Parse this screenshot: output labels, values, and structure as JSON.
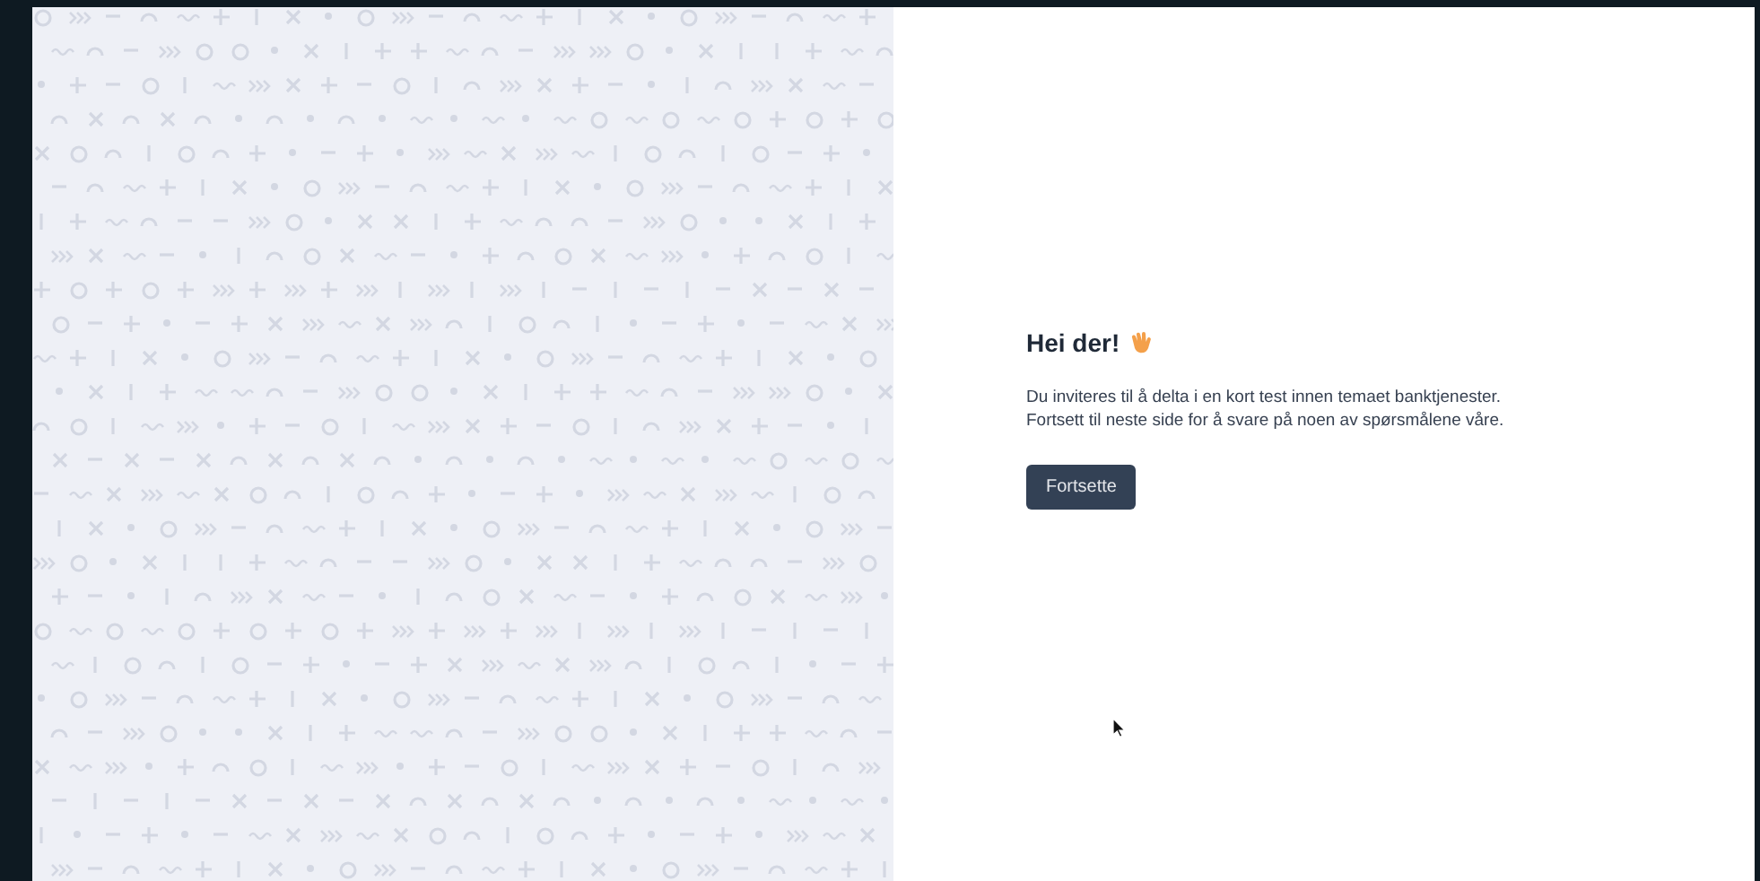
{
  "intro": {
    "heading": "Hei der!",
    "paragraph_lines": [
      "Du inviteres til å delta i en kort test innen temaet banktjenester.",
      "Fortsett til neste side for å svare på noen av spørsmålene våre."
    ],
    "button": "Fortsette"
  }
}
